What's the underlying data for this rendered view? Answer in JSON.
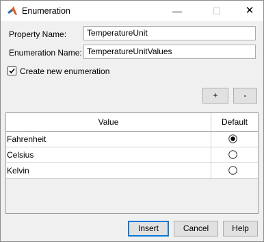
{
  "window": {
    "title": "Enumeration"
  },
  "titlebar": {
    "minimize_glyph": "—",
    "maximize_glyph": "☐",
    "close_glyph": "✕"
  },
  "form": {
    "property_name_label": "Property Name:",
    "property_name_value": "TemperatureUnit",
    "enumeration_name_label": "Enumeration Name:",
    "enumeration_name_value": "TemperatureUnitValues",
    "create_new_label": "Create new enumeration",
    "create_new_checked": true
  },
  "table_toolbar": {
    "add_label": "+",
    "remove_label": "-"
  },
  "table": {
    "headers": [
      "Value",
      "Default"
    ],
    "rows": [
      {
        "value": "Fahrenheit",
        "default": true
      },
      {
        "value": "Celsius",
        "default": false
      },
      {
        "value": "Kelvin",
        "default": false
      }
    ]
  },
  "buttons": {
    "insert": "Insert",
    "cancel": "Cancel",
    "help": "Help"
  },
  "icons": {
    "app": "matlab-icon",
    "checkbox_check": "checkmark-icon",
    "radio_selected": "radio-selected-icon",
    "radio_empty": "radio-empty-icon"
  },
  "colors": {
    "accent": "#0078d7"
  }
}
